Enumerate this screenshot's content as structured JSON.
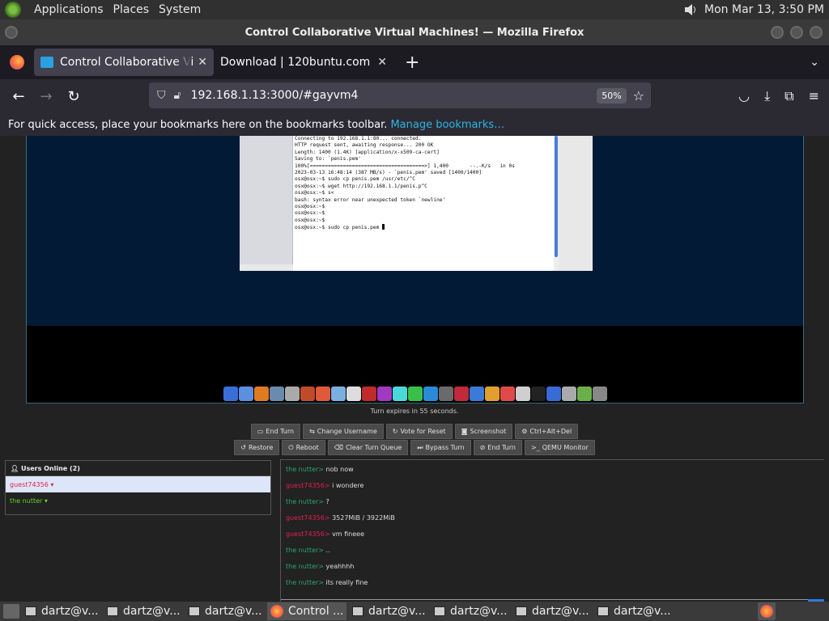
{
  "system_panel": {
    "menus": [
      "Applications",
      "Places",
      "System"
    ],
    "clock": "Mon Mar 13,  3:50 PM"
  },
  "window": {
    "title": "Control Collaborative Virtual Machines! — Mozilla Firefox"
  },
  "tabs": [
    {
      "title": "Control Collaborative Virtual Machines!",
      "active": true
    },
    {
      "title": "Download | 120buntu.com",
      "active": false
    }
  ],
  "navbar": {
    "url": "192.168.1.13:3000/#gayvm4",
    "zoom": "50%"
  },
  "bookmarks_bar": {
    "message": "For quick access, place your bookmarks here on the bookmarks toolbar.",
    "link": "Manage bookmarks…"
  },
  "terminal": {
    "lines": [
      "Connecting to 192.168.1.1:80... connected.",
      "HTTP request sent, awaiting response... 200 OK",
      "Length: 1400 (1.4K) [application/x-x509-ca-cert]",
      "Saving to: `penis.pem'",
      "",
      "100%[======================================>] 1,400       --.-K/s   in 0s",
      "",
      "2023-03-13 16:48:14 (387 MB/s) - `penis.pem' saved [1400/1400]",
      "",
      "osx@osx:~$ sudo cp penis.pem /usr/etc/^C",
      "osx@osx:~$ wget http://192.168.1.1/penis.p^C",
      "osx@osx:~$ s<",
      "bash: syntax error near unexpected token `newline'",
      "osx@osx:~$",
      "osx@osx:~$",
      "osx@osx:~$",
      "osx@osx:~$ sudo cp penis.pem "
    ]
  },
  "dock_colors": [
    "#3a6fd8",
    "#5b8fe0",
    "#e07a20",
    "#6a8ab0",
    "#aaa",
    "#c04a2a",
    "#e05a3a",
    "#7ab0e0",
    "#ddd",
    "#c02a2a",
    "#a03ac0",
    "#4ad8d8",
    "#3ac04a",
    "#2a8ad8",
    "#6a6a6a",
    "#c02a3a",
    "#3a7ad8",
    "#e0a030",
    "#e04a4a",
    "#cfcfcf",
    "#222",
    "#3a6ad8",
    "#aaa",
    "#6ab04a",
    "#888"
  ],
  "vm_status": {
    "turn": "Turn expires in 55 seconds."
  },
  "controls": {
    "row1": [
      {
        "icon": "▭",
        "label": "End Turn",
        "name": "end-turn-button"
      },
      {
        "icon": "⇆",
        "label": "Change Username",
        "name": "change-username-button"
      },
      {
        "icon": "↻",
        "label": "Vote for Reset",
        "name": "vote-reset-button"
      },
      {
        "icon": "◙",
        "label": "Screenshot",
        "name": "screenshot-button"
      },
      {
        "icon": "⚙",
        "label": "Ctrl+Alt+Del",
        "name": "ctrl-alt-del-button"
      }
    ],
    "row2": [
      {
        "icon": "↺",
        "label": "Restore",
        "name": "restore-button"
      },
      {
        "icon": "⏻",
        "label": "Reboot",
        "name": "reboot-button"
      },
      {
        "icon": "⌫",
        "label": "Clear Turn Queue",
        "name": "clear-queue-button"
      },
      {
        "icon": "⏭",
        "label": "Bypass Turn",
        "name": "bypass-turn-button"
      },
      {
        "icon": "⊘",
        "label": "End Turn",
        "name": "end-turn-admin-button"
      },
      {
        "icon": ">_",
        "label": "QEMU Monitor",
        "name": "qemu-monitor-button"
      }
    ]
  },
  "users": {
    "header": "Users Online (2)",
    "list": [
      {
        "name": "guest74356 ▾",
        "me": true
      },
      {
        "name": "the nutter ▾",
        "me": false
      }
    ]
  },
  "chat": [
    {
      "user": "the nutter>",
      "cls": "u1",
      "msg": "nob now"
    },
    {
      "user": "guest74356>",
      "cls": "u2",
      "msg": "i wondere"
    },
    {
      "user": "the nutter>",
      "cls": "u1",
      "msg": "?"
    },
    {
      "user": "guest74356>",
      "cls": "u2",
      "msg": "3527MiB / 3922MiB"
    },
    {
      "user": "guest74356>",
      "cls": "u2",
      "msg": "vm fineee"
    },
    {
      "user": "the nutter>",
      "cls": "u1",
      "msg": ".."
    },
    {
      "user": "the nutter>",
      "cls": "u1",
      "msg": "yeahhhh"
    },
    {
      "user": "the nutter>",
      "cls": "u1",
      "msg": "its really fine"
    }
  ],
  "taskbar": [
    {
      "label": "dartz@v...",
      "type": "term",
      "active": false
    },
    {
      "label": "dartz@v...",
      "type": "term",
      "active": false
    },
    {
      "label": "dartz@v...",
      "type": "term",
      "active": false
    },
    {
      "label": "Control ...",
      "type": "ff",
      "active": true
    },
    {
      "label": "dartz@v...",
      "type": "term",
      "active": false
    },
    {
      "label": "dartz@v...",
      "type": "term",
      "active": false
    },
    {
      "label": "dartz@v...",
      "type": "term",
      "active": false
    },
    {
      "label": "dartz@v...",
      "type": "term",
      "active": false
    }
  ]
}
